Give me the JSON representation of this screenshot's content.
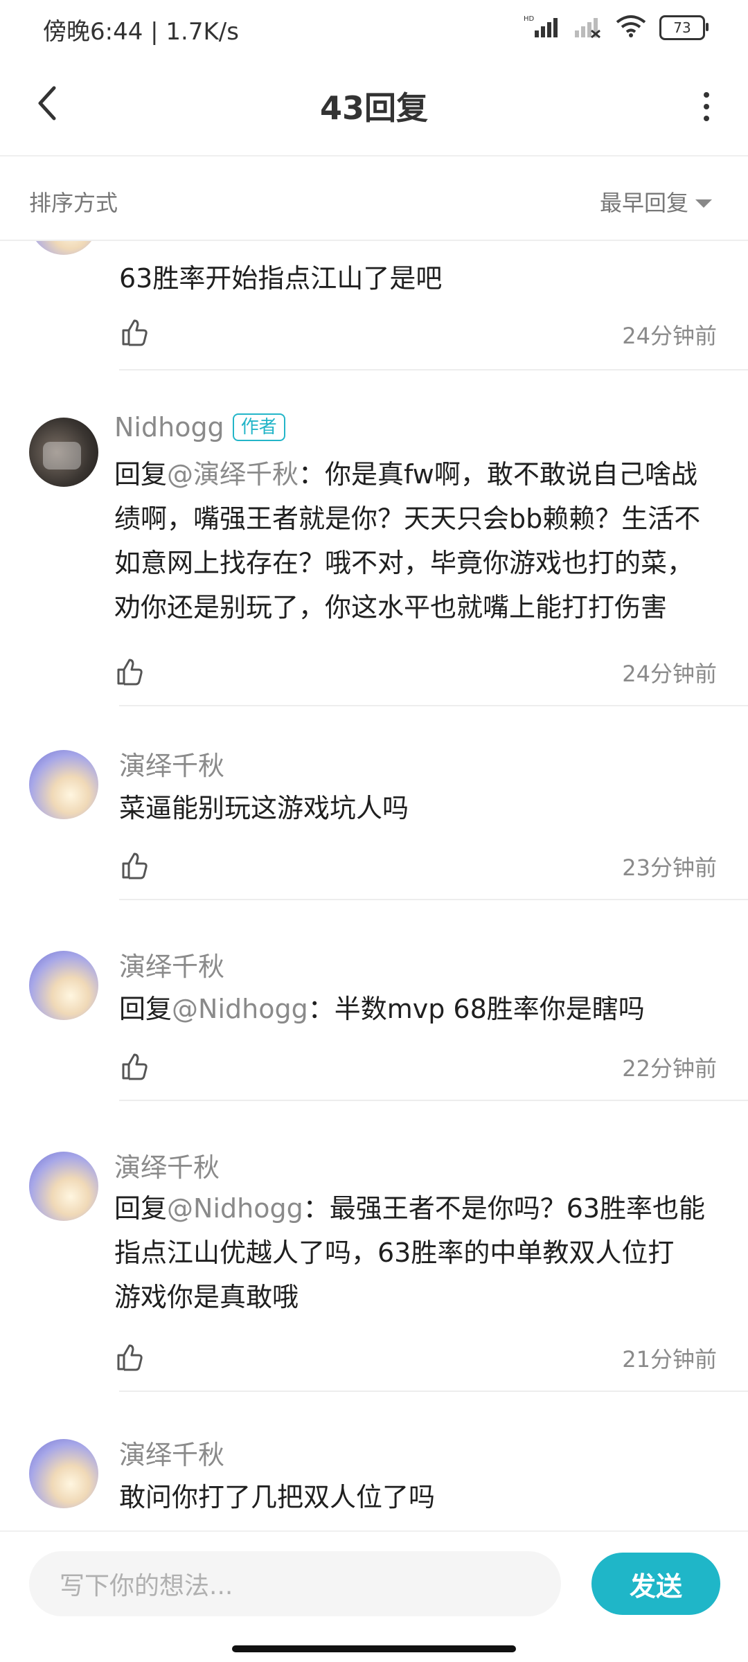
{
  "status": {
    "time_speed": "傍晚6:44 | 1.7K/s",
    "network": "HD",
    "battery": "73"
  },
  "header": {
    "title": "43回复"
  },
  "sort": {
    "label": "排序方式",
    "value": "最早回复"
  },
  "comments": [
    {
      "avatar": "sky",
      "name": "",
      "text": "63胜率开始指点江山了是吧",
      "time": "24分钟前"
    },
    {
      "avatar": "dark",
      "name": "Nidhogg",
      "badge": "作者",
      "reply_prefix": "回复",
      "mention": "@演绎千秋",
      "text_lines": [
        "：你是真fw啊，敢不敢说自己啥战",
        "绩啊，嘴强王者就是你？天天只会bb赖赖？生活不",
        "如意网上找存在？哦不对，毕竟你游戏也打的菜，",
        "劝你还是别玩了，你这水平也就嘴上能打打伤害"
      ],
      "time": "24分钟前"
    },
    {
      "avatar": "sky",
      "name": "演绎千秋",
      "text": "菜逼能别玩这游戏坑人吗",
      "time": "23分钟前"
    },
    {
      "avatar": "sky",
      "name": "演绎千秋",
      "reply_prefix": "回复",
      "mention": "@Nidhogg",
      "text": "：半数mvp  68胜率你是瞎吗",
      "time": "22分钟前"
    },
    {
      "avatar": "sky",
      "name": "演绎千秋",
      "reply_prefix": "回复",
      "mention": "@Nidhogg",
      "text_lines": [
        "：最强王者不是你吗？63胜率也能",
        "指点江山优越人了吗，63胜率的中单教双人位打",
        "游戏你是真敢哦"
      ],
      "time": "21分钟前"
    },
    {
      "avatar": "sky",
      "name": "演绎千秋",
      "text": "敢问你打了几把双人位了吗"
    }
  ],
  "composer": {
    "placeholder": "写下你的想法...",
    "send_label": "发送"
  },
  "colors": {
    "accent": "#1fb6c8",
    "muted": "#8a8a8a",
    "text": "#1f1f1f"
  }
}
